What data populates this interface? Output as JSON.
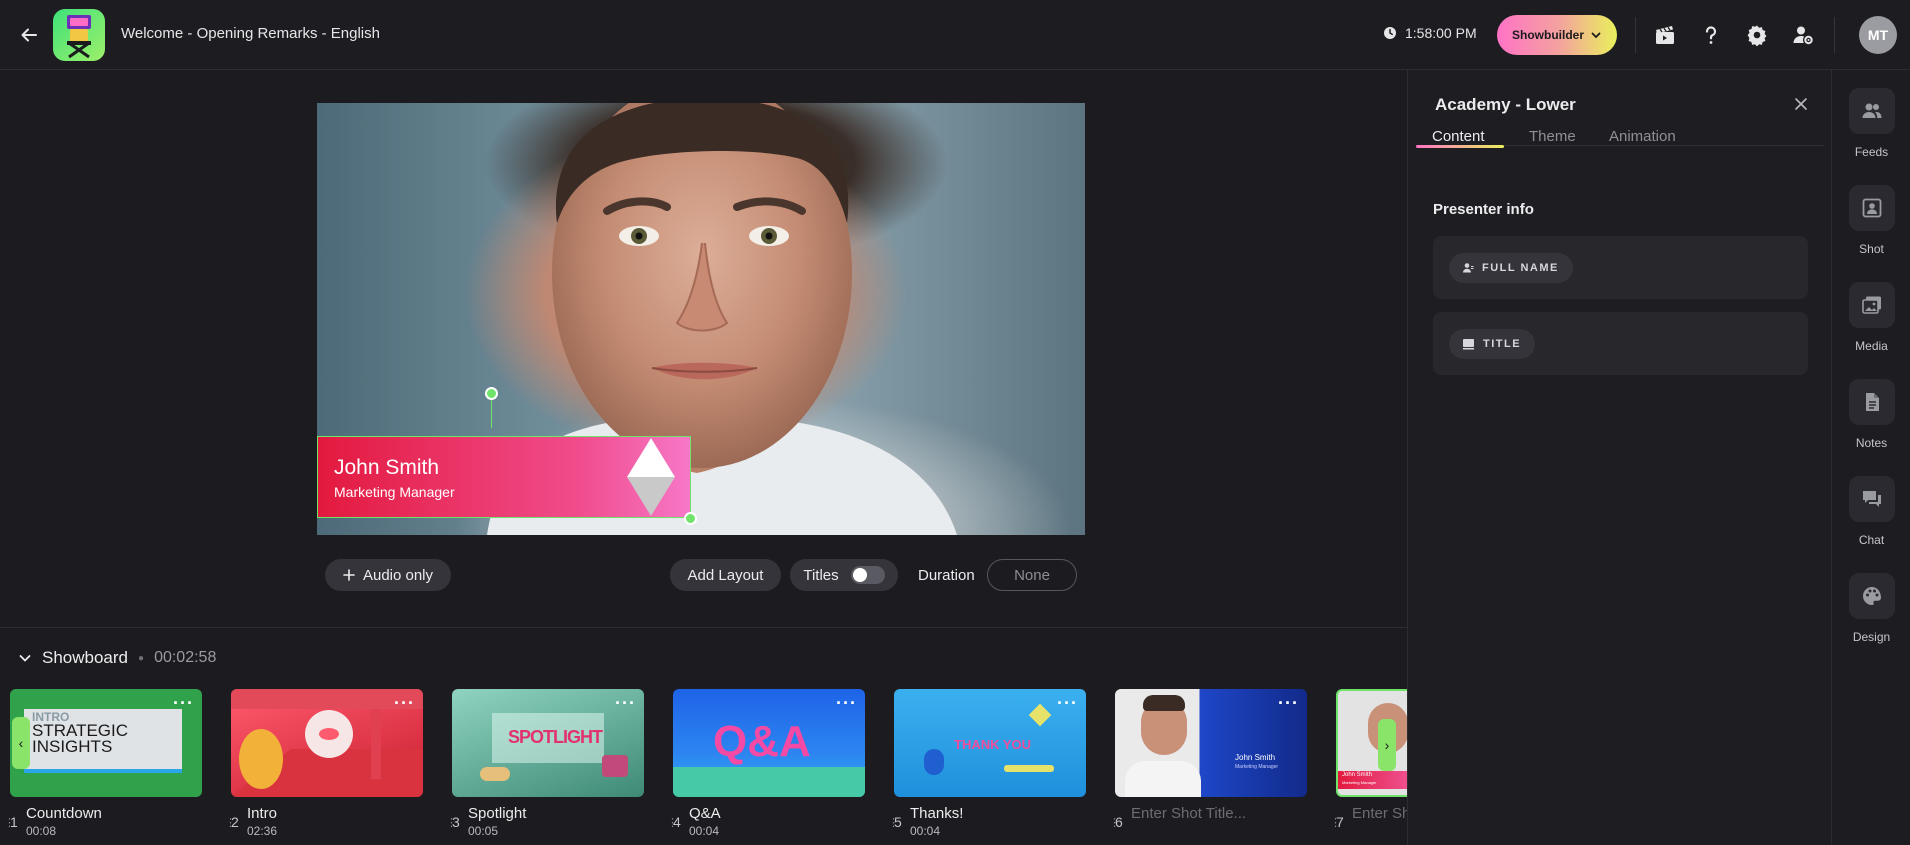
{
  "header": {
    "title": "Welcome  - Opening Remarks - English",
    "clock": "1:58:00 PM",
    "showbuilder_label": "Showbuilder",
    "avatar_initials": "MT"
  },
  "preview": {
    "lower_third_name": "John Smith",
    "lower_third_role": "Marketing Manager"
  },
  "controls": {
    "audio_only": "Audio only",
    "add_layout": "Add Layout",
    "titles": "Titles",
    "titles_enabled": false,
    "duration_label": "Duration",
    "duration_value": "None"
  },
  "showboard": {
    "title": "Showboard",
    "total_time": "00:02:58",
    "cards": [
      {
        "num": "1",
        "title": "Countdown",
        "time": "00:08",
        "thumb_text": [
          "INTRO",
          "STRATEGIC",
          "INSIGHTS"
        ]
      },
      {
        "num": "2",
        "title": "Intro",
        "time": "02:36"
      },
      {
        "num": "3",
        "title": "Spotlight",
        "time": "00:05",
        "thumb_text": "SPOTLIGHT"
      },
      {
        "num": "4",
        "title": "Q&A",
        "time": "00:04",
        "thumb_text": "Q&A"
      },
      {
        "num": "5",
        "title": "Thanks!",
        "time": "00:04",
        "thumb_text": "THANK YOU"
      },
      {
        "num": "6",
        "placeholder": "Enter Shot Title...",
        "thumb_name": "John Smith",
        "thumb_role": "Marketing Manager"
      },
      {
        "num": "7",
        "placeholder": "Enter Shot Title...",
        "thumb_name": "John Smith",
        "thumb_role": "Marketing Manager"
      }
    ]
  },
  "panel": {
    "title": "Academy - Lower",
    "tabs": [
      "Content",
      "Theme",
      "Animation"
    ],
    "section": "Presenter info",
    "fields": [
      "FULL NAME",
      "TITLE"
    ]
  },
  "rail": {
    "items": [
      "Feeds",
      "Shot",
      "Media",
      "Notes",
      "Chat",
      "Design"
    ]
  },
  "colors": {
    "accent_green": "#6fe36a",
    "lower_third_start": "#e3193e",
    "lower_third_end": "#f678c8"
  }
}
